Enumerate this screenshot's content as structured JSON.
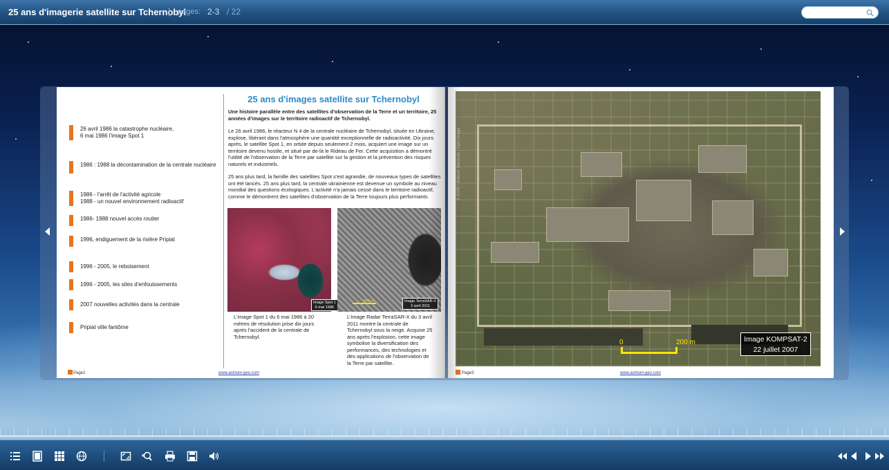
{
  "header": {
    "title": "25 ans d'imagerie satellite sur Tchernobyl",
    "separator": "|",
    "pages_label": "pages:",
    "pages_value": "2-3",
    "pages_total": "/ 22",
    "search_placeholder": ""
  },
  "left_page": {
    "timeline": [
      "26 avril 1986 la catastrophe nucléaire,\n6 mai 1986 l'image Spot 1",
      "1986 : 1988 la décontamination de la centrale nucléaire",
      "1986 - l'arrêt de l'activité agricole\n1988 - un nouvel environnement radioactif",
      "1986- 1988  nouvel accès routier",
      "1996, endiguement de la rivière Pripiat",
      "1996 - 2005, le reboisement",
      "1996 - 2005, les sites d'enfouissements",
      "2007 nouvelles activités dans la centrale",
      "Pripiat ville fantôme"
    ],
    "article_title": "25 ans d'images satellite sur Tchernobyl",
    "article_subtitle": "Une histoire parallèle entre des satellites d'observation de la Terre et un territoire, 25 années d'images sur le  territoire radioactif de Tchernobyl.",
    "paragraph1": "Le 26 avril 1986, le réacteur N 4 de la centrale nucléaire de Tchernobyl, située en Ukraine, explose, libérant dans l'atmosphère une quantité exceptionnelle de radioactivité. Dix jours après, le satellite Spot 1, en orbite depuis seulement 2 mois, acquiert une image sur un territoire devenu hostile, et situé par de-là le Rideau de Fer. Cette acquisition a démontré l'utilité de l'observation de la  Terre par satellite sur la gestion et la prévention des risques naturels et industriels.",
    "paragraph2": "25 ans plus tard, la famille des satellites Spot s'est agrandie, de nouveaux types de satellites ont été lancés. 25 ans plus tard, la centrale ukrainienne est devenue un symbole au niveau mondial des questions écologiques. L'activité n'a jamais cessé dans le territoire radioactif, comme le démontrent des satellites d'observation de la Terre toujours plus performants.",
    "spot_tag": "Image Spot 1\n6 mai 1986",
    "radar_tag": "Image TerraSAR-X\n3 avril 2011",
    "radar_scale": "500 m",
    "caption_spot": "L'image Spot 1 du 6 mai 1986 à 20 mètres de résolution prise dix jours après l'accident de la centrale de Tchernobyl.",
    "caption_radar": "L'image Radar TerraSAR-X du 3 avril 2011 montre la centrale de Tchernobyl sous la neige. Acquise 25 ans après l'explosion, cette image symbolise la diversification des performances, des technologies et des applications de l'observation de la Terre par satellite.",
    "footer_page": "Page2",
    "footer_link": "www.astrium-geo.com"
  },
  "right_page": {
    "image_label_line1": "Image KOMPSAT-2",
    "image_label_line2": "22 juillet 2007",
    "scale_0": "0",
    "scale_200": "200 m",
    "credit": "© KARI / Astrium Services / Spot Image",
    "footer_page": "Page3",
    "footer_link": "www.astrium-geo.com"
  },
  "toolbar_icons": [
    "list-icon",
    "book-icon",
    "grid-icon",
    "globe-icon",
    "fullscreen-icon",
    "zoom-in-icon",
    "print-icon",
    "save-icon",
    "sound-icon",
    "first-page-icon",
    "prev-page-icon",
    "next-page-icon",
    "last-page-icon"
  ],
  "colors": {
    "accent_orange": "#e8741e",
    "title_blue": "#2b8bc9",
    "scale_yellow": "#ffe600"
  }
}
